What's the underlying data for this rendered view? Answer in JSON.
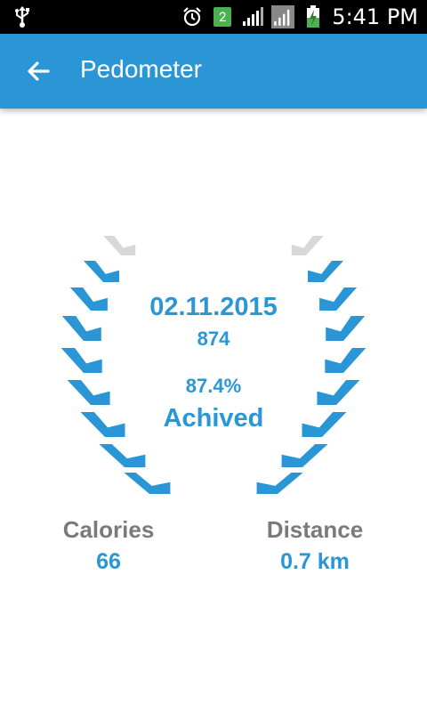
{
  "status_bar": {
    "time": "5:41 PM",
    "notification_badge": "2",
    "icons": [
      "usb-icon",
      "alarm-icon",
      "notification-badge",
      "signal-icon",
      "signal-icon-2",
      "battery-charging-icon"
    ]
  },
  "app_bar": {
    "title": "Pedometer",
    "back_icon": "arrow-left-icon",
    "color": "#2a96d6"
  },
  "summary": {
    "date": "02.11.2015",
    "steps": "874",
    "percent": "87.4%",
    "status": "Achived",
    "progress_fraction": 0.874,
    "accent_color": "#2a96d6",
    "inactive_color": "#d8d8d8"
  },
  "stats": {
    "calories_label": "Calories",
    "calories_value": "66",
    "distance_label": "Distance",
    "distance_value": "0.7 km"
  }
}
